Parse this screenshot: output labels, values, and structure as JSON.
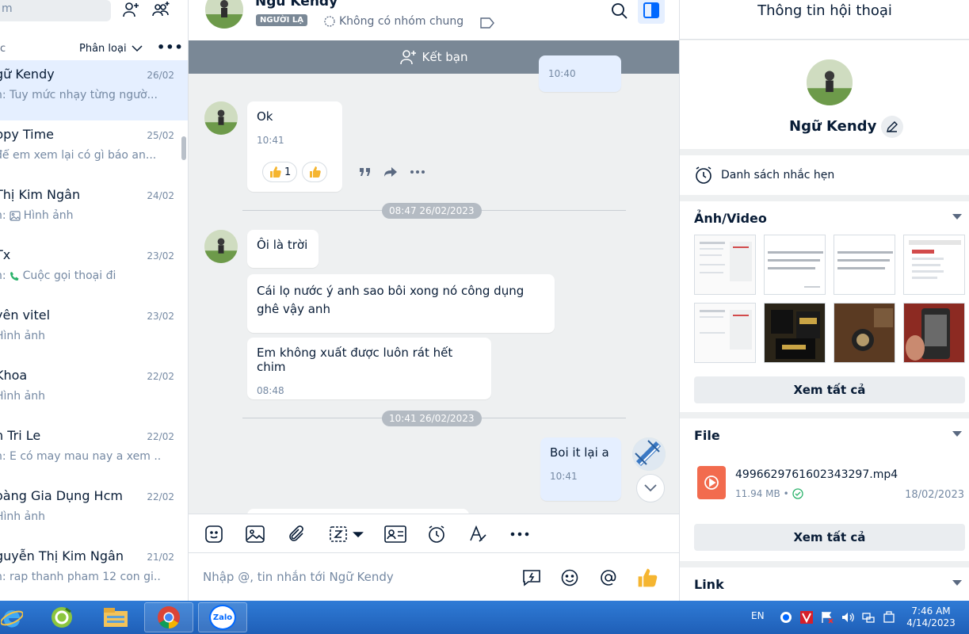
{
  "sidebar": {
    "search_placeholder": "m",
    "filter_label": "ác",
    "sort_label": "Phân loại",
    "more_label": "•••",
    "conversations": [
      {
        "name": "gữ Kendy",
        "time": "26/02",
        "preview": "n: Tuy mức nhạy từng ngườ...",
        "preview_icon": ""
      },
      {
        "name": "ppy Time",
        "time": "25/02",
        "preview": "để em xem lại có gì báo an...",
        "preview_icon": ""
      },
      {
        "name": " Thị Kim Ngân",
        "time": "24/02",
        "preview": "n: Hình ảnh",
        "preview_icon": "image"
      },
      {
        "name": " Tx",
        "time": "23/02",
        "preview": "n: Cuộc gọi thoại đi",
        "preview_icon": "phone"
      },
      {
        "name": "yên vitel",
        "time": "23/02",
        "preview": "Hình ảnh",
        "preview_icon": ""
      },
      {
        "name": " Khoa",
        "time": "22/02",
        "preview": "Hình ảnh",
        "preview_icon": ""
      },
      {
        "name": "n Tri Le",
        "time": "22/02",
        "preview": "n: E có may mau nay a xem ...",
        "preview_icon": ""
      },
      {
        "name": "oàng Gia Dụng Hcm",
        "time": "22/02",
        "preview": "Hình ảnh",
        "preview_icon": ""
      },
      {
        "name": "guyễn Thị Kim Ngân",
        "time": "21/02",
        "preview": "n: rap thanh pham 12 con gi...",
        "preview_icon": ""
      }
    ]
  },
  "chat": {
    "name": "Ngữ Kendy",
    "badge": "NGƯỜI LẠ",
    "no_common_group": "Không có nhóm chung",
    "add_friend": "Kết bạn",
    "top_partial_time": "10:40",
    "messages": [
      {
        "text": "Ok",
        "time": "10:41"
      },
      {
        "text": "Ôi là trời",
        "time": ""
      },
      {
        "text": "Cái lọ nước ý anh sao bôi xong nó công dụng ghê vậy anh",
        "time": ""
      },
      {
        "text": "Em không xuất được luôn rát hết chim",
        "time": "08:48"
      },
      {
        "text": "Boi it lại  a",
        "time": "10:41"
      }
    ],
    "reaction_count": "1",
    "date_dividers": [
      "08:47 26/02/2023",
      "10:41 26/02/2023"
    ],
    "composer_placeholder": "Nhập @, tin nhắn tới Ngữ Kendy"
  },
  "info_panel": {
    "title": "Thông tin hội thoại",
    "profile_name": "Ngữ Kendy",
    "reminders": "Danh sách nhắc hẹn",
    "media_title": "Ảnh/Video",
    "view_all": "Xem tất cả",
    "file_title": "File",
    "file_name": "4996629761602343297.mp4",
    "file_size": "11.94 MB •",
    "file_date": "18/02/2023",
    "link_title": "Link"
  },
  "taskbar": {
    "zalo_label": "Zalo",
    "lang": "EN",
    "time": "7:46 AM",
    "date": "4/14/2023"
  },
  "colors": {
    "accent": "#0068ff",
    "active_row": "#e5efff",
    "stranger_bar": "#7a8896",
    "file_icon": "#f26b4e"
  }
}
